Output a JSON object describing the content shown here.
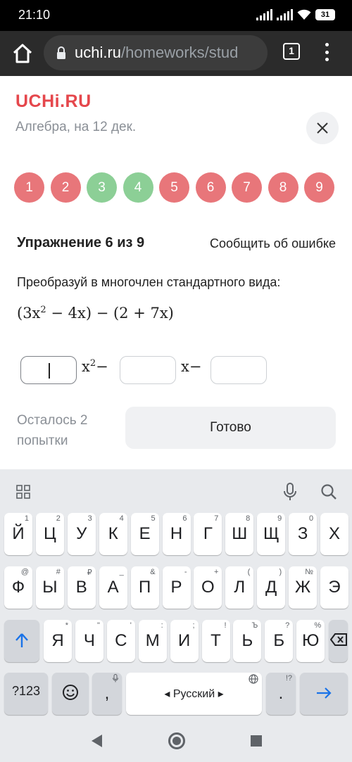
{
  "status_bar": {
    "time": "21:10",
    "battery": "31"
  },
  "browser": {
    "url_host": "uchi.ru",
    "url_path": "/homeworks/stud",
    "tab_count": "1"
  },
  "header": {
    "logo": "UCHi.RU",
    "subject": "Алгебра, на 12 дек."
  },
  "steps": [
    {
      "label": "1",
      "state": "wrong"
    },
    {
      "label": "2",
      "state": "wrong"
    },
    {
      "label": "3",
      "state": "correct"
    },
    {
      "label": "4",
      "state": "correct"
    },
    {
      "label": "5",
      "state": "wrong"
    },
    {
      "label": "6",
      "state": "wrong"
    },
    {
      "label": "7",
      "state": "wrong"
    },
    {
      "label": "8",
      "state": "wrong"
    },
    {
      "label": "9",
      "state": "wrong"
    }
  ],
  "colors": {
    "wrong": "#e8767a",
    "correct": "#8ccf96",
    "brand": "#e5474c"
  },
  "exercise": {
    "title": "Упражнение 6 из 9",
    "report": "Сообщить об ошибке",
    "task": "Преобразуй в многочлен стандартного вида:",
    "formula": {
      "p1": "(3x",
      "e1": "2",
      "p2": " − 4x) − (2 + 7x)"
    },
    "answer": {
      "x2_label": "x",
      "x2_exp": "2",
      "minus1": "−",
      "x_label": "x−",
      "inputs": [
        "",
        "",
        ""
      ]
    },
    "attempts": "Осталось 2 попытки",
    "done": "Готово"
  },
  "keyboard": {
    "language": "Русский",
    "row1": [
      {
        "k": "Й",
        "a": "1"
      },
      {
        "k": "Ц",
        "a": "2"
      },
      {
        "k": "У",
        "a": "3"
      },
      {
        "k": "К",
        "a": "4"
      },
      {
        "k": "Е",
        "a": "5"
      },
      {
        "k": "Н",
        "a": "6"
      },
      {
        "k": "Г",
        "a": "7"
      },
      {
        "k": "Ш",
        "a": "8"
      },
      {
        "k": "Щ",
        "a": "9"
      },
      {
        "k": "З",
        "a": "0"
      },
      {
        "k": "Х",
        "a": ""
      }
    ],
    "row2": [
      {
        "k": "Ф",
        "a": "@"
      },
      {
        "k": "Ы",
        "a": "#"
      },
      {
        "k": "В",
        "a": "₽"
      },
      {
        "k": "А",
        "a": "_"
      },
      {
        "k": "П",
        "a": "&"
      },
      {
        "k": "Р",
        "a": "-"
      },
      {
        "k": "О",
        "a": "+"
      },
      {
        "k": "Л",
        "a": "("
      },
      {
        "k": "Д",
        "a": ")"
      },
      {
        "k": "Ж",
        "a": "№"
      },
      {
        "k": "Э",
        "a": ""
      }
    ],
    "row3": [
      {
        "k": "Я",
        "a": "*"
      },
      {
        "k": "Ч",
        "a": "\""
      },
      {
        "k": "С",
        "a": "'"
      },
      {
        "k": "М",
        "a": ":"
      },
      {
        "k": "И",
        "a": ";"
      },
      {
        "k": "Т",
        "a": "!"
      },
      {
        "k": "Ь",
        "a": "Ъ"
      },
      {
        "k": "Б",
        "a": "?"
      },
      {
        "k": "Ю",
        "a": "%"
      }
    ],
    "sym_key": "?123",
    "comma": ",",
    "period": ".",
    "period_alt": "!?"
  }
}
